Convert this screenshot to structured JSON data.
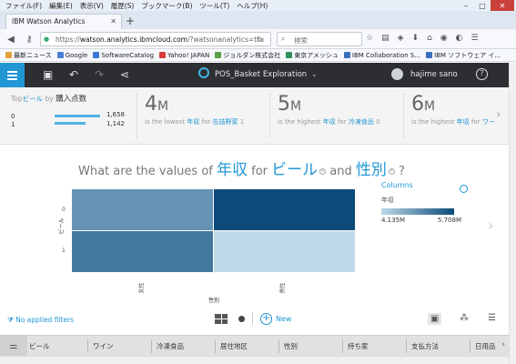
{
  "window": {
    "menu": [
      "ファイル(F)",
      "編集(E)",
      "表示(V)",
      "履歴(S)",
      "ブックマーク(B)",
      "ツール(T)",
      "ヘルプ(H)"
    ],
    "tab_title": "IBM Watson Analytics",
    "url_host": "watson.analytics.ibmcloud.com",
    "url_prefix": "https://",
    "url_path": "/?watsonanalytics=tru",
    "search_placeholder": "検索",
    "bookmarks": [
      "最新ニュース",
      "Google",
      "SoftwareCatalog",
      "Yahoo! JAPAN",
      "ジョルダン株式会社",
      "東京アメッシュ",
      "IBM Collaboration S...",
      "IBM ソフトウェア イ..."
    ]
  },
  "app": {
    "title": "POS_Basket Exploration",
    "user": "hajime sano"
  },
  "insights": {
    "top": {
      "prefix": "Top",
      "field": "ビール",
      "by": "by",
      "measure": "購入点数",
      "rows": [
        {
          "key": "0",
          "value": "1,658",
          "frac": 0.86
        },
        {
          "key": "1",
          "value": "1,142",
          "frac": 0.59
        }
      ]
    },
    "cards": [
      {
        "num": "4",
        "unit": "M",
        "pre": "is the lowest",
        "field": "年収",
        "for": "for",
        "item": "缶詰野菜",
        "tail": "1"
      },
      {
        "num": "5",
        "unit": "M",
        "pre": "is the highest",
        "field": "年収",
        "for": "for",
        "item": "冷凍食品",
        "tail": "0"
      },
      {
        "num": "6",
        "unit": "M",
        "pre": "is the highest",
        "field": "年収",
        "for": "for",
        "item": "ワー",
        "tail": ""
      }
    ]
  },
  "question": {
    "a": "What are the values of",
    "k1": "年収",
    "b": "for",
    "k2": "ビール",
    "c": "and",
    "k3": "性別",
    "d": "?"
  },
  "chart_data": {
    "type": "heatmap",
    "title": "",
    "xlabel": "性別",
    "ylabel": "ビール",
    "x_categories": [
      "女性",
      "男性"
    ],
    "y_categories": [
      "0",
      "1"
    ],
    "value_label": "年収",
    "values": [
      [
        4.9,
        5.708
      ],
      [
        5.2,
        4.135
      ]
    ],
    "color_range": [
      4.135,
      5.708
    ],
    "colors": {
      "low": "#bdd9e8",
      "high": "#0b4a7a"
    }
  },
  "legend": {
    "title": "Columns",
    "measure": "年収",
    "min": "4.135M",
    "max": "5.708M"
  },
  "controls": {
    "filters": "No applied filters",
    "new": "New"
  },
  "columns": [
    "ビール",
    "ワイン",
    "冷凍食品",
    "居住地区",
    "性別",
    "持ち家",
    "支払方法",
    "日用品"
  ]
}
